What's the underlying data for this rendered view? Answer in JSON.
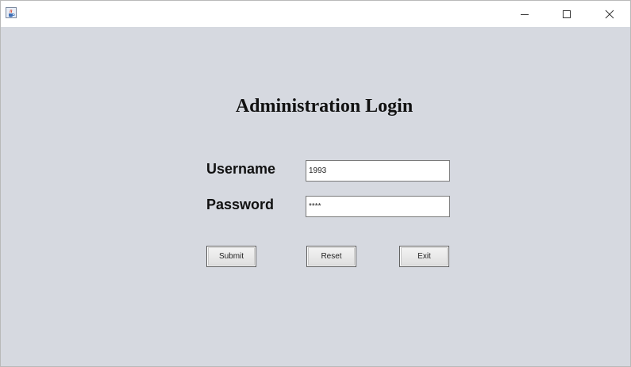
{
  "window": {
    "app_icon": "java-cup-icon",
    "controls": {
      "minimize_icon": "minimize-icon",
      "maximize_icon": "maximize-icon",
      "close_icon": "close-icon"
    }
  },
  "form": {
    "title": "Administration Login",
    "username_label": "Username",
    "username_value": "1993",
    "password_label": "Password",
    "password_value": "****",
    "buttons": {
      "submit": "Submit",
      "reset": "Reset",
      "exit": "Exit"
    }
  },
  "colors": {
    "background": "#d6d9e0",
    "titlebar": "#ffffff"
  }
}
